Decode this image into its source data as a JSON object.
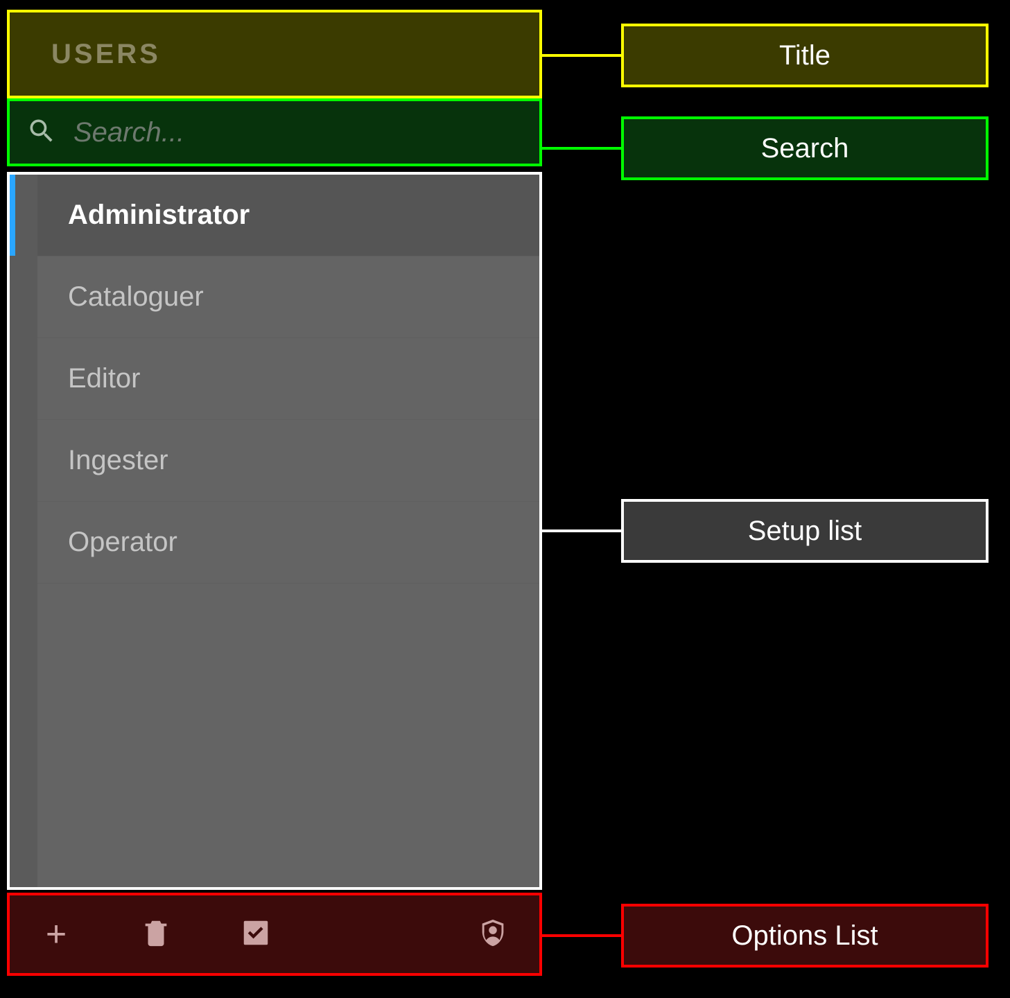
{
  "panel": {
    "title": "USERS",
    "search_placeholder": "Search..."
  },
  "users": [
    {
      "name": "Administrator",
      "selected": true
    },
    {
      "name": "Cataloguer",
      "selected": false
    },
    {
      "name": "Editor",
      "selected": false
    },
    {
      "name": "Ingester",
      "selected": false
    },
    {
      "name": "Operator",
      "selected": false
    }
  ],
  "options": {
    "add_icon": "plus-icon",
    "delete_icon": "trash-icon",
    "enable_icon": "check-icon",
    "shield_icon": "shield-user-icon"
  },
  "callouts": {
    "title": "Title",
    "search": "Search",
    "list": "Setup list",
    "options": "Options List"
  }
}
